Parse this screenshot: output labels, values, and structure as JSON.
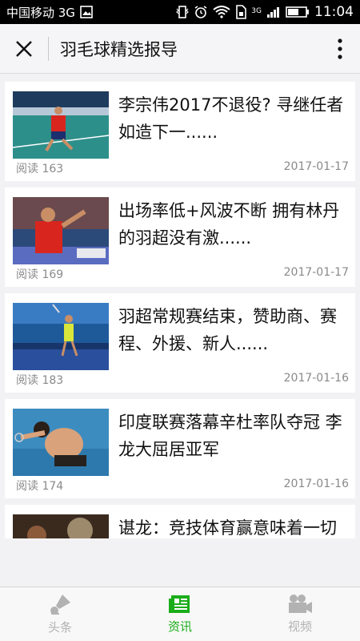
{
  "status_bar": {
    "carrier": "中国移动 3G",
    "time": "11:04",
    "network": "3G"
  },
  "nav": {
    "title": "羽毛球精选报导"
  },
  "articles": [
    {
      "title": "李宗伟2017不退役? 寻继任者如造下一......",
      "reads": "阅读 163",
      "date": "2017-01-17"
    },
    {
      "title": "出场率低+风波不断 拥有林丹的羽超没有激......",
      "reads": "阅读 169",
      "date": "2017-01-17"
    },
    {
      "title": "羽超常规赛结束，赞助商、赛程、外援、新人......",
      "reads": "阅读 183",
      "date": "2017-01-16"
    },
    {
      "title": "印度联赛落幕辛杜率队夺冠 李龙大屈居亚军",
      "reads": "阅读 174",
      "date": "2017-01-16"
    },
    {
      "title": "谌龙：竞技体育赢意味着一切",
      "reads": "",
      "date": ""
    }
  ],
  "tabs": [
    {
      "label": "头条",
      "icon": "shuttlecock-icon",
      "active": false
    },
    {
      "label": "资讯",
      "icon": "news-icon",
      "active": true
    },
    {
      "label": "视频",
      "icon": "video-camera-icon",
      "active": false
    }
  ],
  "colors": {
    "accent": "#1aad19",
    "inactive": "#b2b2b2",
    "text_secondary": "#8a8a8a"
  }
}
